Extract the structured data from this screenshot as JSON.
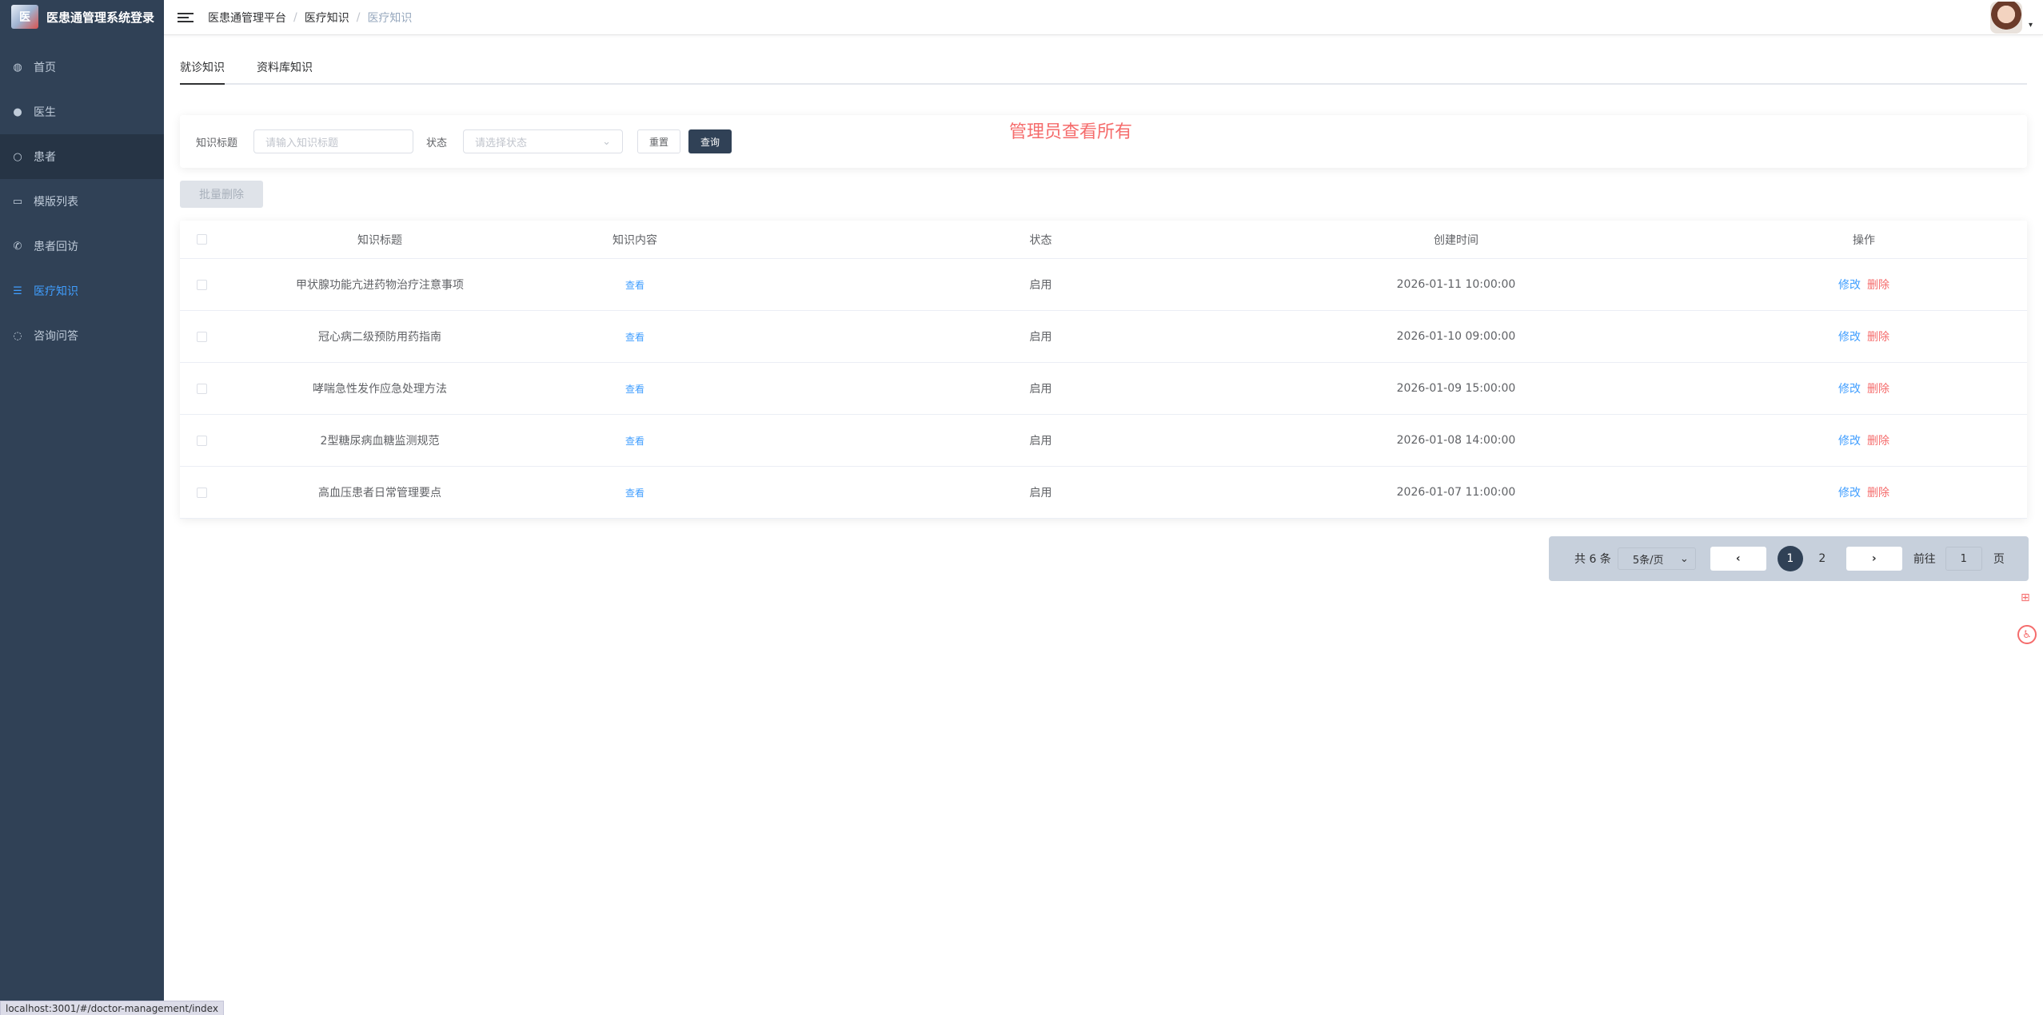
{
  "sidebar": {
    "brand_logo_text": "医",
    "brand_title": "医患通管理系统登录",
    "items": [
      {
        "label": "首页",
        "icon": "dashboard-icon"
      },
      {
        "label": "医生",
        "icon": "user-icon"
      },
      {
        "label": "患者",
        "icon": "person-outline-icon"
      },
      {
        "label": "模版列表",
        "icon": "document-icon"
      },
      {
        "label": "患者回访",
        "icon": "phone-icon"
      },
      {
        "label": "医疗知识",
        "icon": "list-icon"
      },
      {
        "label": "咨询问答",
        "icon": "chat-icon"
      }
    ],
    "active_index": 5,
    "hover_index": 2
  },
  "header": {
    "breadcrumb": [
      "医患通管理平台",
      "医疗知识",
      "医疗知识"
    ],
    "avatar_caret": "▾"
  },
  "tabs": [
    "就诊知识",
    "资料库知识"
  ],
  "search": {
    "title_label": "知识标题",
    "title_placeholder": "请输入知识标题",
    "status_label": "状态",
    "status_placeholder": "请选择状态",
    "reset_label": "重置",
    "query_label": "查询",
    "admin_note": "管理员查看所有"
  },
  "batch_delete_label": "批量删除",
  "table": {
    "columns": [
      "知识标题",
      "知识内容",
      "状态",
      "创建时间",
      "操作"
    ],
    "view_label": "查看",
    "edit_label": "修改",
    "delete_label": "删除",
    "rows": [
      {
        "title": "甲状腺功能亢进药物治疗注意事项",
        "status": "启用",
        "created": "2026-01-11 10:00:00"
      },
      {
        "title": "冠心病二级预防用药指南",
        "status": "启用",
        "created": "2026-01-10 09:00:00"
      },
      {
        "title": "哮喘急性发作应急处理方法",
        "status": "启用",
        "created": "2026-01-09 15:00:00"
      },
      {
        "title": "2型糖尿病血糖监测规范",
        "status": "启用",
        "created": "2026-01-08 14:00:00"
      },
      {
        "title": "高血压患者日常管理要点",
        "status": "启用",
        "created": "2026-01-07 11:00:00"
      }
    ]
  },
  "pagination": {
    "total_text": "共 6 条",
    "page_size": "5条/页",
    "prev": "‹",
    "next": "›",
    "pages": [
      "1",
      "2"
    ],
    "current_page": "1",
    "goto_label": "前往",
    "goto_value": "1",
    "goto_suffix": "页"
  },
  "statusbar": "localhost:3001/#/doctor-management/index",
  "colors": {
    "sidebar_bg": "#304156",
    "accent": "#409eff",
    "danger": "#f56c6c"
  }
}
